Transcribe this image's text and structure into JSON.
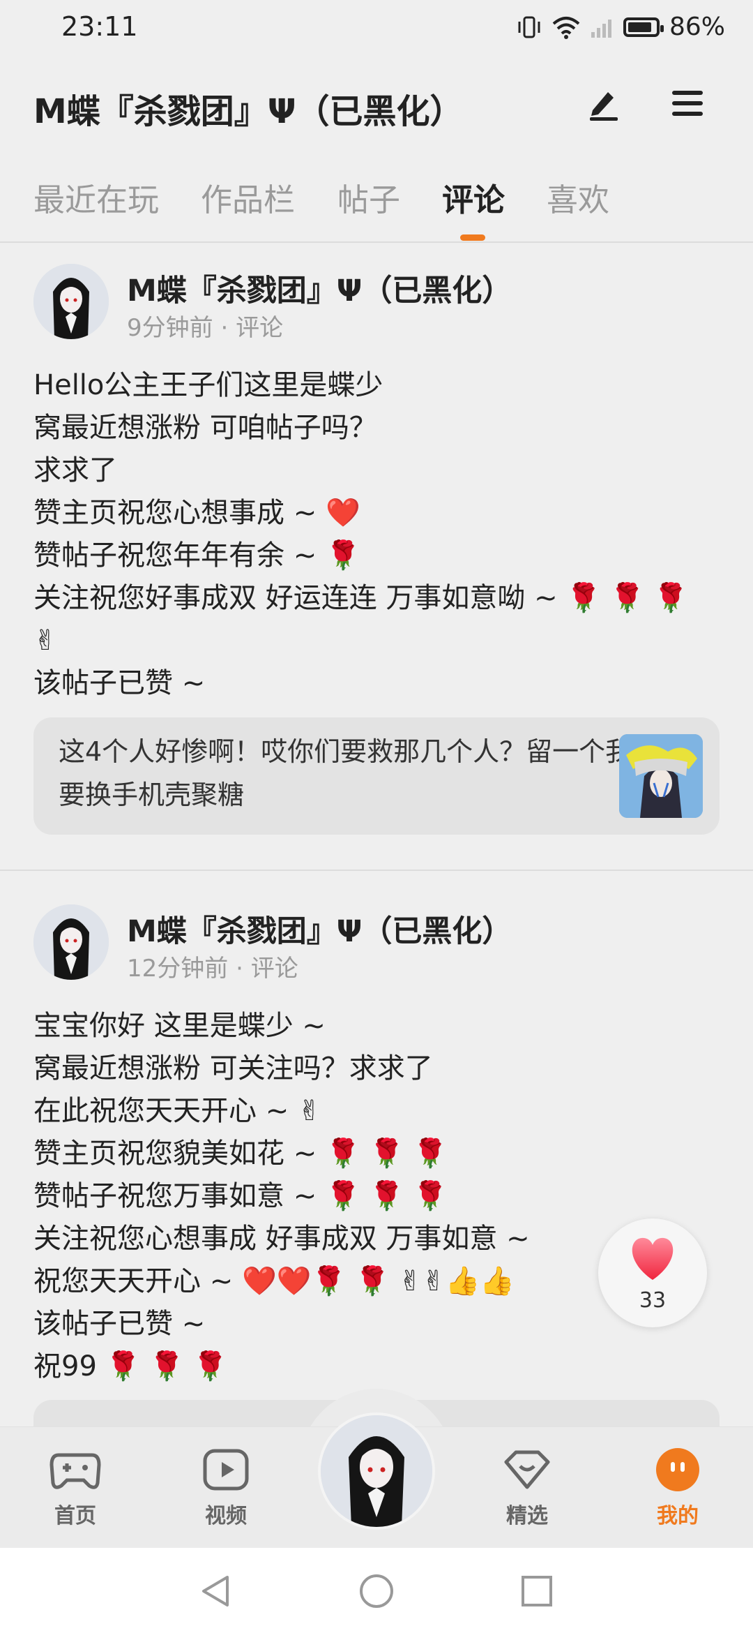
{
  "status_bar": {
    "time": "23:11",
    "battery": "86%",
    "battery_level": 0.86
  },
  "header": {
    "title": "M蝶『杀戮团』Ψ（已黑化）"
  },
  "tabs": [
    {
      "label": "最近在玩",
      "active": false
    },
    {
      "label": "作品栏",
      "active": false
    },
    {
      "label": "帖子",
      "active": false
    },
    {
      "label": "评论",
      "active": true
    },
    {
      "label": "喜欢",
      "active": false
    }
  ],
  "posts": [
    {
      "author": "M蝶『杀戮团』Ψ（已黑化）",
      "time": "9分钟前",
      "type": "评论",
      "lines": [
        "Hello公主王子们这里是蝶少",
        "窝最近想涨粉 可咱帖子吗？",
        "求求了",
        "赞主页祝您心想事成 ~ ❤️",
        "赞帖子祝您年年有余 ~ 🌹",
        "关注祝您好事成双 好运连连 万事如意呦 ~ 🌹 🌹 🌹",
        "✌",
        "该帖子已赞 ~"
      ],
      "quote": "这4个人好惨啊！哎你们要救那几个人？留一个我要换手机壳聚糖"
    },
    {
      "author": "M蝶『杀戮团』Ψ（已黑化）",
      "time": "12分钟前",
      "type": "评论",
      "lines": [
        "宝宝你好 这里是蝶少 ~",
        "窝最近想涨粉 可关注吗？求求了",
        "在此祝您天天开心 ~ ✌",
        "赞主页祝您貌美如花 ~ 🌹 🌹 🌹",
        "赞帖子祝您万事如意 ~ 🌹 🌹 🌹",
        "关注祝您心想事成 好事成双 万事如意 ~",
        "祝您天天开心 ~ ❤️❤️🌹 🌹 ✌✌👍👍",
        "该帖子已赞 ~",
        "祝99 🌹 🌹 🌹"
      ]
    }
  ],
  "like_fab": {
    "count": "33"
  },
  "bottom_nav": [
    {
      "label": "首页",
      "icon": "gamepad-icon",
      "active": false
    },
    {
      "label": "视频",
      "icon": "play-icon",
      "active": false
    },
    {
      "label": "精选",
      "icon": "heart-badge-icon",
      "active": false
    },
    {
      "label": "我的",
      "icon": "smile-icon",
      "active": true
    }
  ],
  "colors": {
    "accent": "#f07a1e",
    "background": "#efefef"
  }
}
